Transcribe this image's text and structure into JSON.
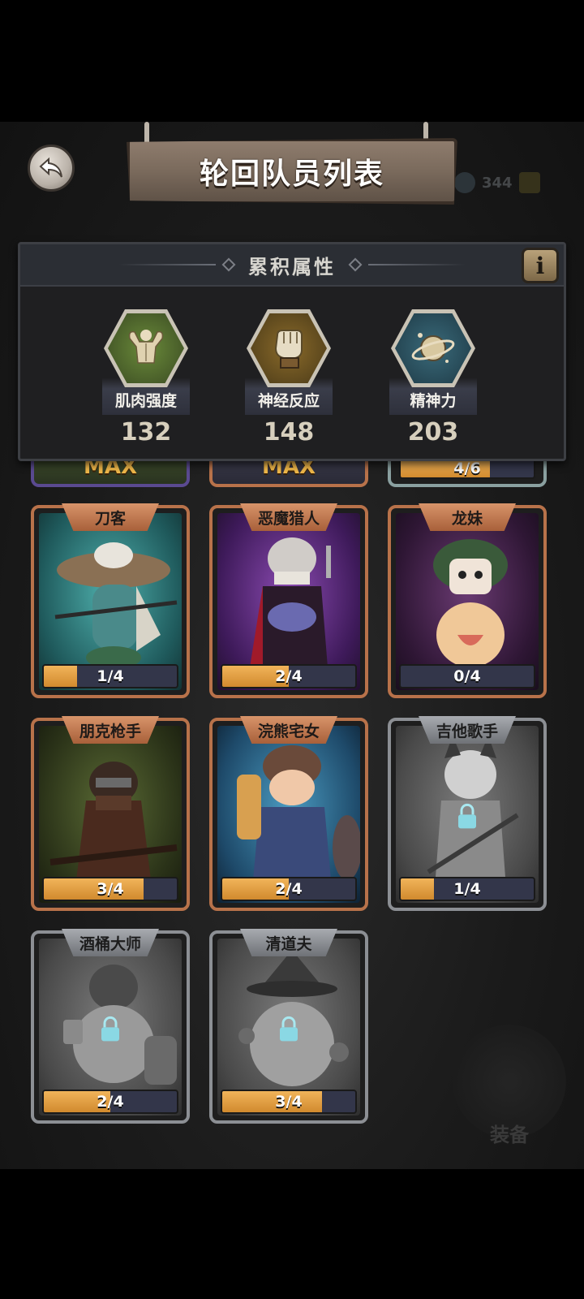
{
  "header": {
    "title": "轮回队员列表",
    "back_icon": "back-arrow-icon"
  },
  "stats": {
    "title": "累积属性",
    "info_label": "i",
    "items": [
      {
        "label": "肌肉强度",
        "value": "132",
        "icon": "muscle-icon"
      },
      {
        "label": "神经反应",
        "value": "148",
        "icon": "fist-icon"
      },
      {
        "label": "精神力",
        "value": "203",
        "icon": "planet-icon"
      }
    ]
  },
  "partial_row": [
    {
      "text": "MAX"
    },
    {
      "text": "MAX"
    },
    {
      "text": "4/6",
      "progress": 0.67
    }
  ],
  "members": [
    {
      "name": "刀客",
      "progress_text": "1/4",
      "progress": 0.25,
      "locked": false,
      "bg": "#2e8a8c"
    },
    {
      "name": "恶魔猎人",
      "progress_text": "2/4",
      "progress": 0.5,
      "locked": false,
      "bg": "#5b2c86"
    },
    {
      "name": "龙妹",
      "progress_text": "0/4",
      "progress": 0.0,
      "locked": false,
      "bg": "#4a2a52"
    },
    {
      "name": "朋克枪手",
      "progress_text": "3/4",
      "progress": 0.75,
      "locked": false,
      "bg": "#3d4a24"
    },
    {
      "name": "浣熊宅女",
      "progress_text": "2/4",
      "progress": 0.5,
      "locked": false,
      "bg": "#2f6b8c"
    },
    {
      "name": "吉他歌手",
      "progress_text": "1/4",
      "progress": 0.25,
      "locked": true,
      "bg": "#6a6a6a"
    },
    {
      "name": "酒桶大师",
      "progress_text": "2/4",
      "progress": 0.5,
      "locked": true,
      "bg": "#6a6a6a"
    },
    {
      "name": "清道夫",
      "progress_text": "3/4",
      "progress": 0.75,
      "locked": true,
      "bg": "#6a6a6a"
    }
  ],
  "background": {
    "currency_value": "344",
    "equip_label": "装备"
  },
  "colors": {
    "progress_fill": "#d18a2e",
    "card_border_unlocked": "#b8724a",
    "card_border_locked": "#8c8f94"
  }
}
